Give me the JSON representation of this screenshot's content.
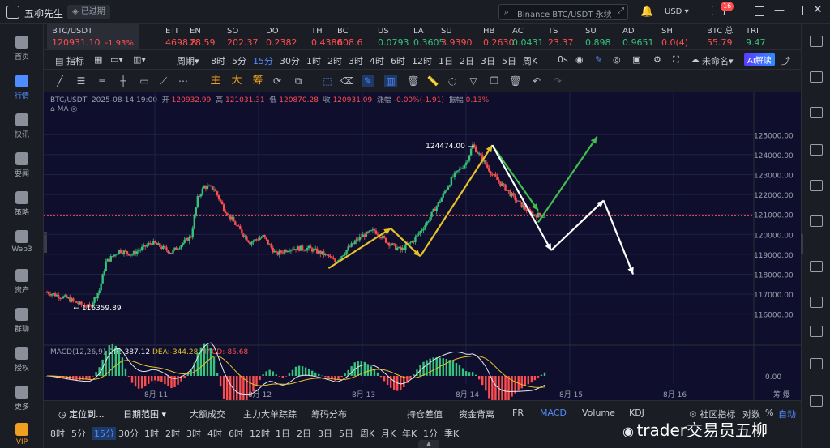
{
  "app": {
    "title": "五柳先生",
    "status": "已过期",
    "search_placeholder": "Binance BTC/USDT 永续",
    "currency": "USD",
    "notif_count": "16"
  },
  "nav": [
    {
      "label": "首页"
    },
    {
      "label": "行情",
      "active": true
    },
    {
      "label": "快讯"
    },
    {
      "label": "要闻"
    },
    {
      "label": "策略"
    },
    {
      "label": "Web3"
    },
    {
      "label": "资产"
    },
    {
      "label": "群聊"
    },
    {
      "label": "授权"
    },
    {
      "label": "更多"
    },
    {
      "label": "VIP"
    }
  ],
  "tickers": [
    {
      "name": "BTC/USDT",
      "price": "120931.10",
      "change": "-1.93%",
      "color": "dn",
      "active": true
    },
    {
      "name": "ETI",
      "price": "4698.8",
      "color": "dn"
    },
    {
      "name": "EN",
      "price": "28.59",
      "color": "dn"
    },
    {
      "name": "SO",
      "price": "202.37",
      "color": "dn"
    },
    {
      "name": "DO",
      "price": "0.2382",
      "color": "dn"
    },
    {
      "name": "TH",
      "price": "0.4380",
      "color": "dn"
    },
    {
      "name": "BC",
      "price": "608.6",
      "color": "dn"
    },
    {
      "name": "US",
      "price": "0.0793",
      "color": "up"
    },
    {
      "name": "LA",
      "price": "0.3605",
      "color": "up"
    },
    {
      "name": "SU",
      "price": "3.9390",
      "color": "dn"
    },
    {
      "name": "HB",
      "price": "0.2630",
      "color": "dn"
    },
    {
      "name": "AC",
      "price": "0.0431",
      "color": "up"
    },
    {
      "name": "TS",
      "price": "23.37",
      "color": "dn"
    },
    {
      "name": "SU",
      "price": "0.898",
      "color": "up"
    },
    {
      "name": "AD",
      "price": "0.9651",
      "color": "up"
    },
    {
      "name": "SH",
      "price": "0.0(4)",
      "color": "dn"
    },
    {
      "name": "BTC 总",
      "price": "55.79",
      "color": "dn"
    },
    {
      "name": "TRI",
      "price": "9.47",
      "color": "up"
    }
  ],
  "toolbar": {
    "indicator": "指标",
    "period": "周期",
    "intervals": [
      "8时",
      "5分",
      "15分",
      "30分",
      "1时",
      "2时",
      "3时",
      "4时",
      "6时",
      "12时",
      "1日",
      "2日",
      "3日",
      "5日",
      "周K"
    ],
    "selected_interval": "15分",
    "seconds": "0s",
    "unnamed": "未命名",
    "ai": "AI解读",
    "draw_labels": [
      "主",
      "大",
      "筹"
    ]
  },
  "legend": {
    "symbol": "BTC/USDT",
    "time": "2025-08-14 19:00",
    "open_label": "开",
    "open": "120932.99",
    "high_label": "高",
    "high": "121031.31",
    "low_label": "低",
    "low": "120870.28",
    "close_label": "收",
    "close": "120931.09",
    "change_label": "涨幅",
    "change": "-0.00%(-1.91)",
    "amp_label": "振幅",
    "amp": "0.13%",
    "ma": "MA"
  },
  "macd": {
    "label": "MACD(12,26,9)",
    "dif": "DIF:-387.12",
    "dea": "DEA:-344.28",
    "macd": "MACD:-85.68",
    "zero": "0.00"
  },
  "chart_data": {
    "type": "candlestick",
    "y_ticks": [
      125000,
      124000,
      123000,
      122000,
      121000,
      120000,
      119000,
      118000,
      117000,
      116000
    ],
    "ylim": [
      115500,
      125500
    ],
    "x_ticks": [
      "8月 11",
      "8月 12",
      "8月 13",
      "8月 14",
      "8月 15",
      "8月 16"
    ],
    "current_price": 120931.1,
    "high_label": "124474.00",
    "low_label": "116359.89",
    "price_path": [
      [
        0,
        117100
      ],
      [
        6,
        116800
      ],
      [
        10,
        116500
      ],
      [
        13,
        116360
      ],
      [
        16,
        117200
      ],
      [
        18,
        118600
      ],
      [
        22,
        119200
      ],
      [
        26,
        119000
      ],
      [
        32,
        119600
      ],
      [
        38,
        119100
      ],
      [
        44,
        119900
      ],
      [
        46,
        121800
      ],
      [
        48,
        122400
      ],
      [
        51,
        122300
      ],
      [
        54,
        121300
      ],
      [
        58,
        120400
      ],
      [
        62,
        119600
      ],
      [
        66,
        119900
      ],
      [
        70,
        119000
      ],
      [
        74,
        119300
      ],
      [
        80,
        119300
      ],
      [
        86,
        118900
      ],
      [
        88,
        118600
      ],
      [
        92,
        119300
      ],
      [
        96,
        119900
      ],
      [
        100,
        120200
      ],
      [
        104,
        119600
      ],
      [
        108,
        119200
      ],
      [
        112,
        119700
      ],
      [
        116,
        120600
      ],
      [
        120,
        121700
      ],
      [
        124,
        122900
      ],
      [
        128,
        123600
      ],
      [
        130,
        124474
      ],
      [
        132,
        124000
      ],
      [
        136,
        123000
      ],
      [
        140,
        122300
      ],
      [
        144,
        121600
      ],
      [
        148,
        121000
      ],
      [
        152,
        120931
      ]
    ],
    "projections": [
      {
        "color": "#e6c229",
        "points": [
          [
            86,
            118300
          ],
          [
            105,
            120300
          ]
        ]
      },
      {
        "color": "#e6c229",
        "points": [
          [
            105,
            120300
          ],
          [
            114,
            118900
          ]
        ]
      },
      {
        "color": "#e6c229",
        "points": [
          [
            114,
            118900
          ],
          [
            136,
            124474
          ]
        ]
      },
      {
        "color": "#3fbf4a",
        "points": [
          [
            136,
            124474
          ],
          [
            150,
            121200
          ]
        ]
      },
      {
        "color": "#3fbf4a",
        "points": [
          [
            150,
            120600
          ],
          [
            168,
            124900
          ]
        ]
      },
      {
        "color": "#ffffff",
        "points": [
          [
            136,
            124474
          ],
          [
            154,
            119200
          ]
        ]
      },
      {
        "color": "#ffffff",
        "points": [
          [
            154,
            119200
          ],
          [
            170,
            121700
          ]
        ]
      },
      {
        "color": "#ffffff",
        "points": [
          [
            170,
            121700
          ],
          [
            179,
            118000
          ]
        ]
      }
    ]
  },
  "bottom": {
    "locate": "定位到...",
    "range": "日期范围",
    "tabs": [
      "大额成交",
      "主力大单踪踪",
      "筹码分布",
      "持仓差值",
      "资金背离",
      "FR",
      "MACD",
      "Volume",
      "KDJ"
    ],
    "selected_tab": "MACD",
    "community": "社区指标",
    "log": "对数",
    "pct": "%",
    "auto": "自动",
    "intervals": [
      "8时",
      "5分",
      "15分",
      "30分",
      "1时",
      "2时",
      "3时",
      "4时",
      "6时",
      "12时",
      "1日",
      "2日",
      "3日",
      "5日",
      "周K",
      "月K",
      "年K",
      "1分",
      "季K"
    ],
    "selected_interval": "15分",
    "watermark": "trader交易员五柳",
    "corner": "筹 爆"
  }
}
